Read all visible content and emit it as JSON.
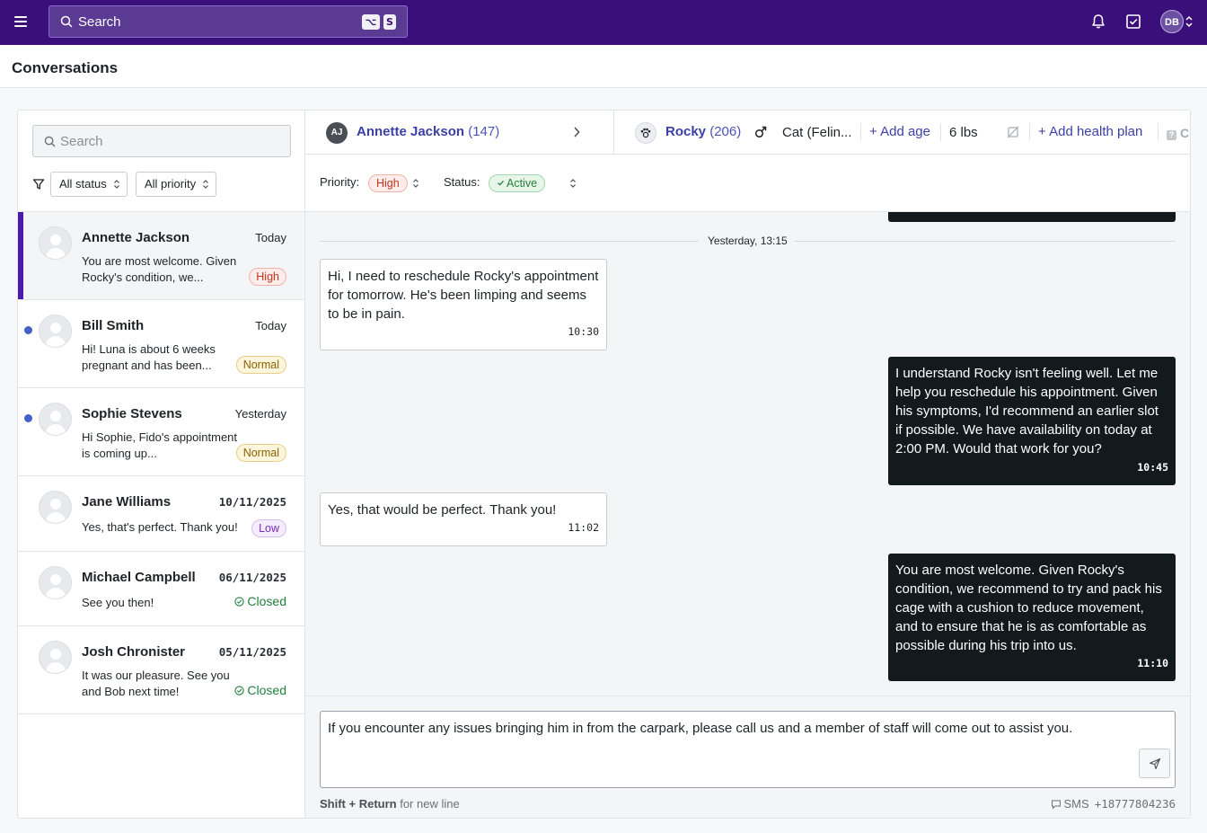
{
  "topbar": {
    "search_label": "Search",
    "shortcut_keys": [
      "⌥",
      "S"
    ],
    "user_initials": "DB"
  },
  "page": {
    "title": "Conversations"
  },
  "sidebar": {
    "search_placeholder": "Search",
    "filters": {
      "status": "All status",
      "priority": "All priority"
    },
    "conversations": [
      {
        "name": "Annette Jackson",
        "date": "Today",
        "preview": "You are most welcome. Given Rocky's condition, we...",
        "tag": "High",
        "unread": false,
        "active": true
      },
      {
        "name": "Bill Smith",
        "date": "Today",
        "preview": "Hi! Luna is about 6 weeks pregnant and has been...",
        "tag": "Normal",
        "unread": true,
        "active": false
      },
      {
        "name": "Sophie Stevens",
        "date": "Yesterday",
        "preview": "Hi Sophie, Fido's appointment is coming up...",
        "tag": "Normal",
        "unread": true,
        "active": false
      },
      {
        "name": "Jane Williams",
        "date": "10/11/2025",
        "preview": "Yes, that's perfect. Thank you!",
        "tag": "Low",
        "unread": false,
        "active": false
      },
      {
        "name": "Michael Campbell",
        "date": "06/11/2025",
        "preview": "See you then!",
        "tag": "Closed",
        "unread": false,
        "active": false
      },
      {
        "name": "Josh Chronister",
        "date": "05/11/2025",
        "preview": "It was our pleasure. See you and Bob next time!",
        "tag": "Closed",
        "unread": false,
        "active": false
      }
    ]
  },
  "context": {
    "client_initials": "AJ",
    "client_name": "Annette Jackson",
    "client_id": "(147)",
    "pet_name": "Rocky",
    "pet_id": "(206)",
    "species": "Cat (Felin...",
    "add_age": "Add age",
    "weight": "6 lbs",
    "add_health_plan": "Add health plan",
    "cpr": "CPR"
  },
  "status_bar": {
    "priority_label": "Priority:",
    "priority_value": "High",
    "status_label": "Status:",
    "status_value": "Active"
  },
  "thread": {
    "date_separator": "Yesterday, 13:15",
    "messages": [
      {
        "direction": "in",
        "text": "Hi, I need to reschedule Rocky's appointment for tomorrow. He's been limping and seems to be in pain.",
        "time": "10:30"
      },
      {
        "direction": "out",
        "text": "I understand Rocky isn't feeling well. Let me help you reschedule his appointment. Given his symptoms, I'd recommend an earlier slot if possible. We have availability on today at 2:00 PM. Would that work for you?",
        "time": "10:45"
      },
      {
        "direction": "in",
        "text": "Yes, that would be perfect. Thank you!",
        "time": "11:02"
      },
      {
        "direction": "out",
        "text": "You are most welcome. Given Rocky's condition, we recommend to try and pack his cage with a cushion to reduce movement, and to ensure that he is as comfortable as possible during his trip into us.",
        "time": "11:10"
      }
    ]
  },
  "composer": {
    "draft": "If you encounter any issues bringing him in from the carpark, please call us and a member of staff will come out to assist you.",
    "hint_key": "Shift + Return",
    "hint_text": " for new line",
    "channel": "SMS",
    "phone": "+18777804236"
  },
  "colors": {
    "topbar": "#3b0f7a",
    "active_accent": "#4b1aa8",
    "outgoing_bubble": "#121a1d",
    "link": "#3b3fa8"
  }
}
